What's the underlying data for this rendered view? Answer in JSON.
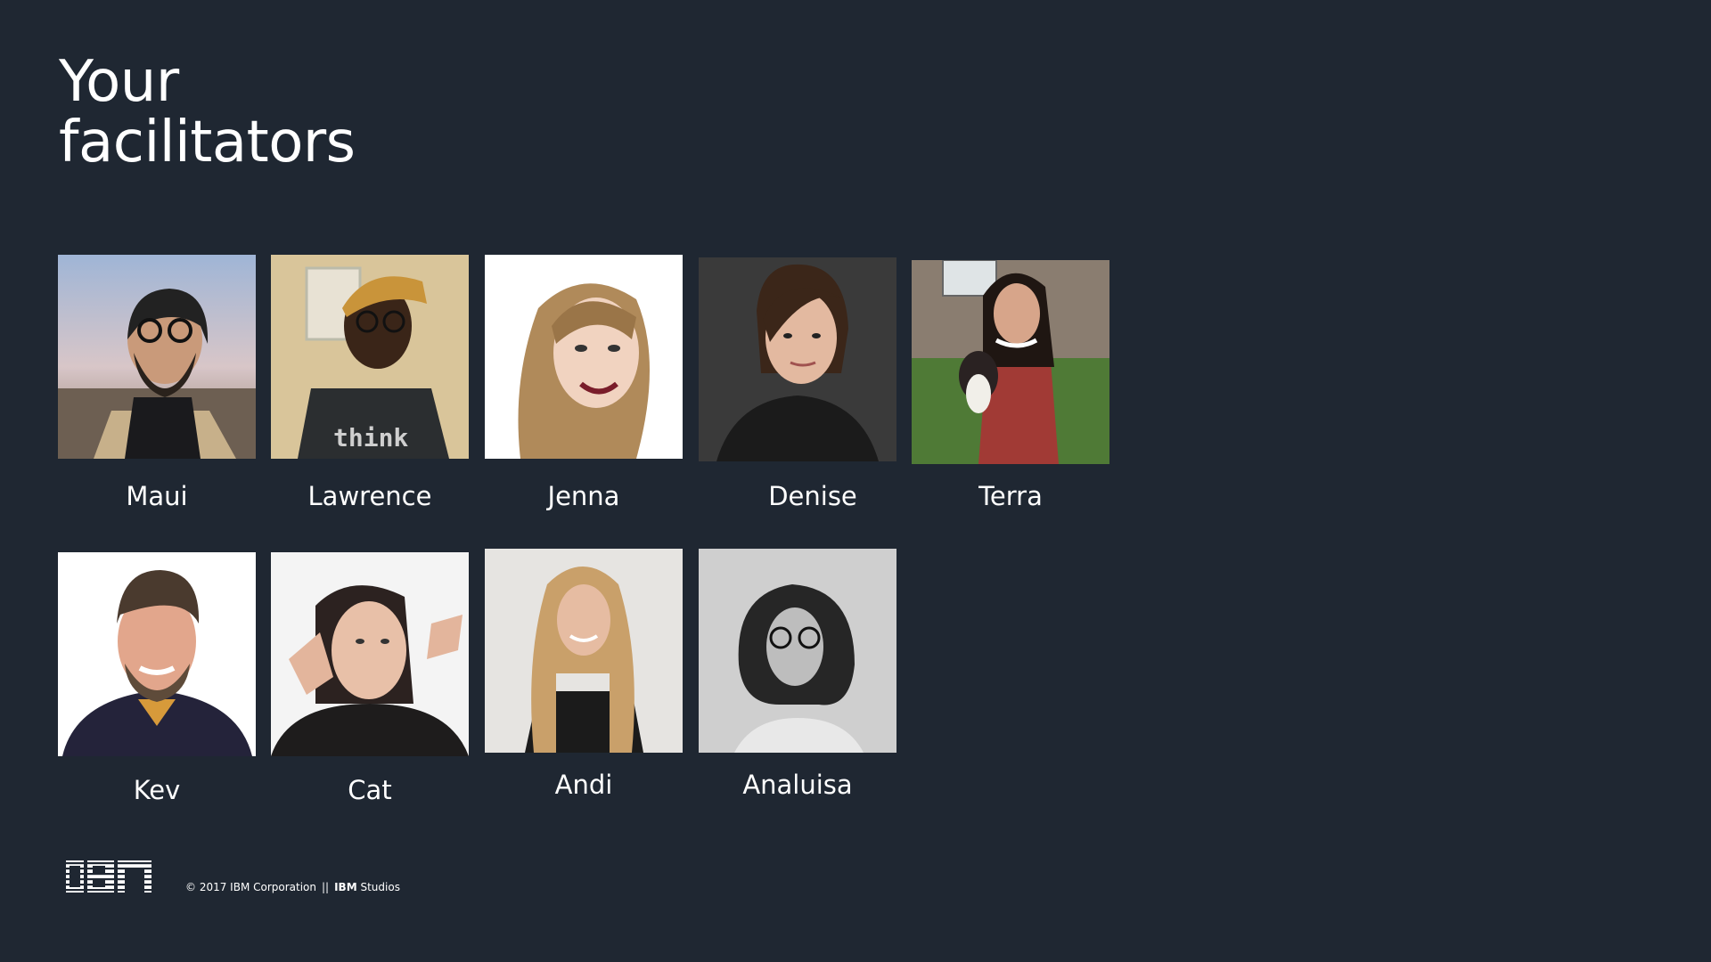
{
  "title": {
    "line1": "Your",
    "line2": "facilitators"
  },
  "facilitators": [
    {
      "name": "Maui"
    },
    {
      "name": "Lawrence"
    },
    {
      "name": "Jenna"
    },
    {
      "name": "Denise"
    },
    {
      "name": "Terra"
    },
    {
      "name": "Kev"
    },
    {
      "name": "Cat"
    },
    {
      "name": "Andi"
    },
    {
      "name": "Analuisa"
    }
  ],
  "footer": {
    "logo": "IBM",
    "copyright": "© 2017 IBM Corporation",
    "separator": "||",
    "studio_brand": "IBM",
    "studio_suffix": "Studios"
  },
  "colors": {
    "background": "#1f2732",
    "text": "#ffffff"
  },
  "icons": [
    "ibm-logo-icon"
  ]
}
